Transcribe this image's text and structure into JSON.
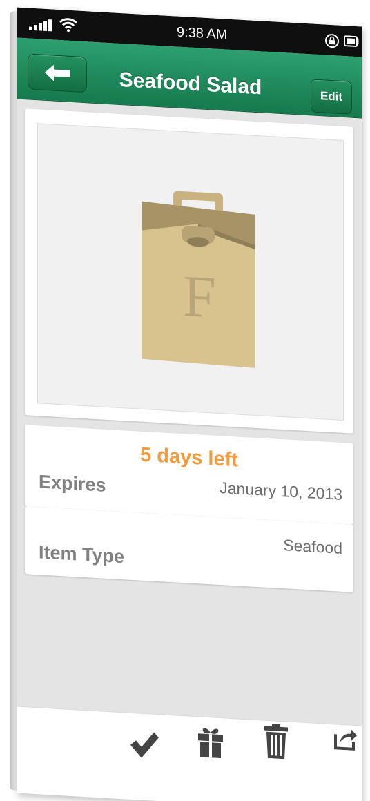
{
  "status_bar": {
    "time": "9:38 AM",
    "icons": [
      "signal-icon",
      "wifi-icon",
      "orientation-lock-icon",
      "battery-icon"
    ]
  },
  "nav_bar": {
    "title": "Seafood Salad",
    "back_icon": "arrow-left-icon",
    "edit_label": "Edit",
    "color": "#1f8a5b"
  },
  "photo": {
    "placeholder_icon": "shopping-bag-icon",
    "placeholder_letter": "F"
  },
  "expiration": {
    "countdown": "5 days left",
    "countdown_color": "#f39a3c",
    "label": "Expires",
    "value": "January 10, 2013"
  },
  "item_type": {
    "label": "Item Type",
    "value": "Seafood"
  },
  "toolbar": {
    "items": [
      {
        "name": "done",
        "icon": "checkmark-icon"
      },
      {
        "name": "donate",
        "icon": "gift-icon"
      },
      {
        "name": "delete",
        "icon": "trash-icon"
      },
      {
        "name": "share",
        "icon": "share-icon"
      }
    ]
  }
}
